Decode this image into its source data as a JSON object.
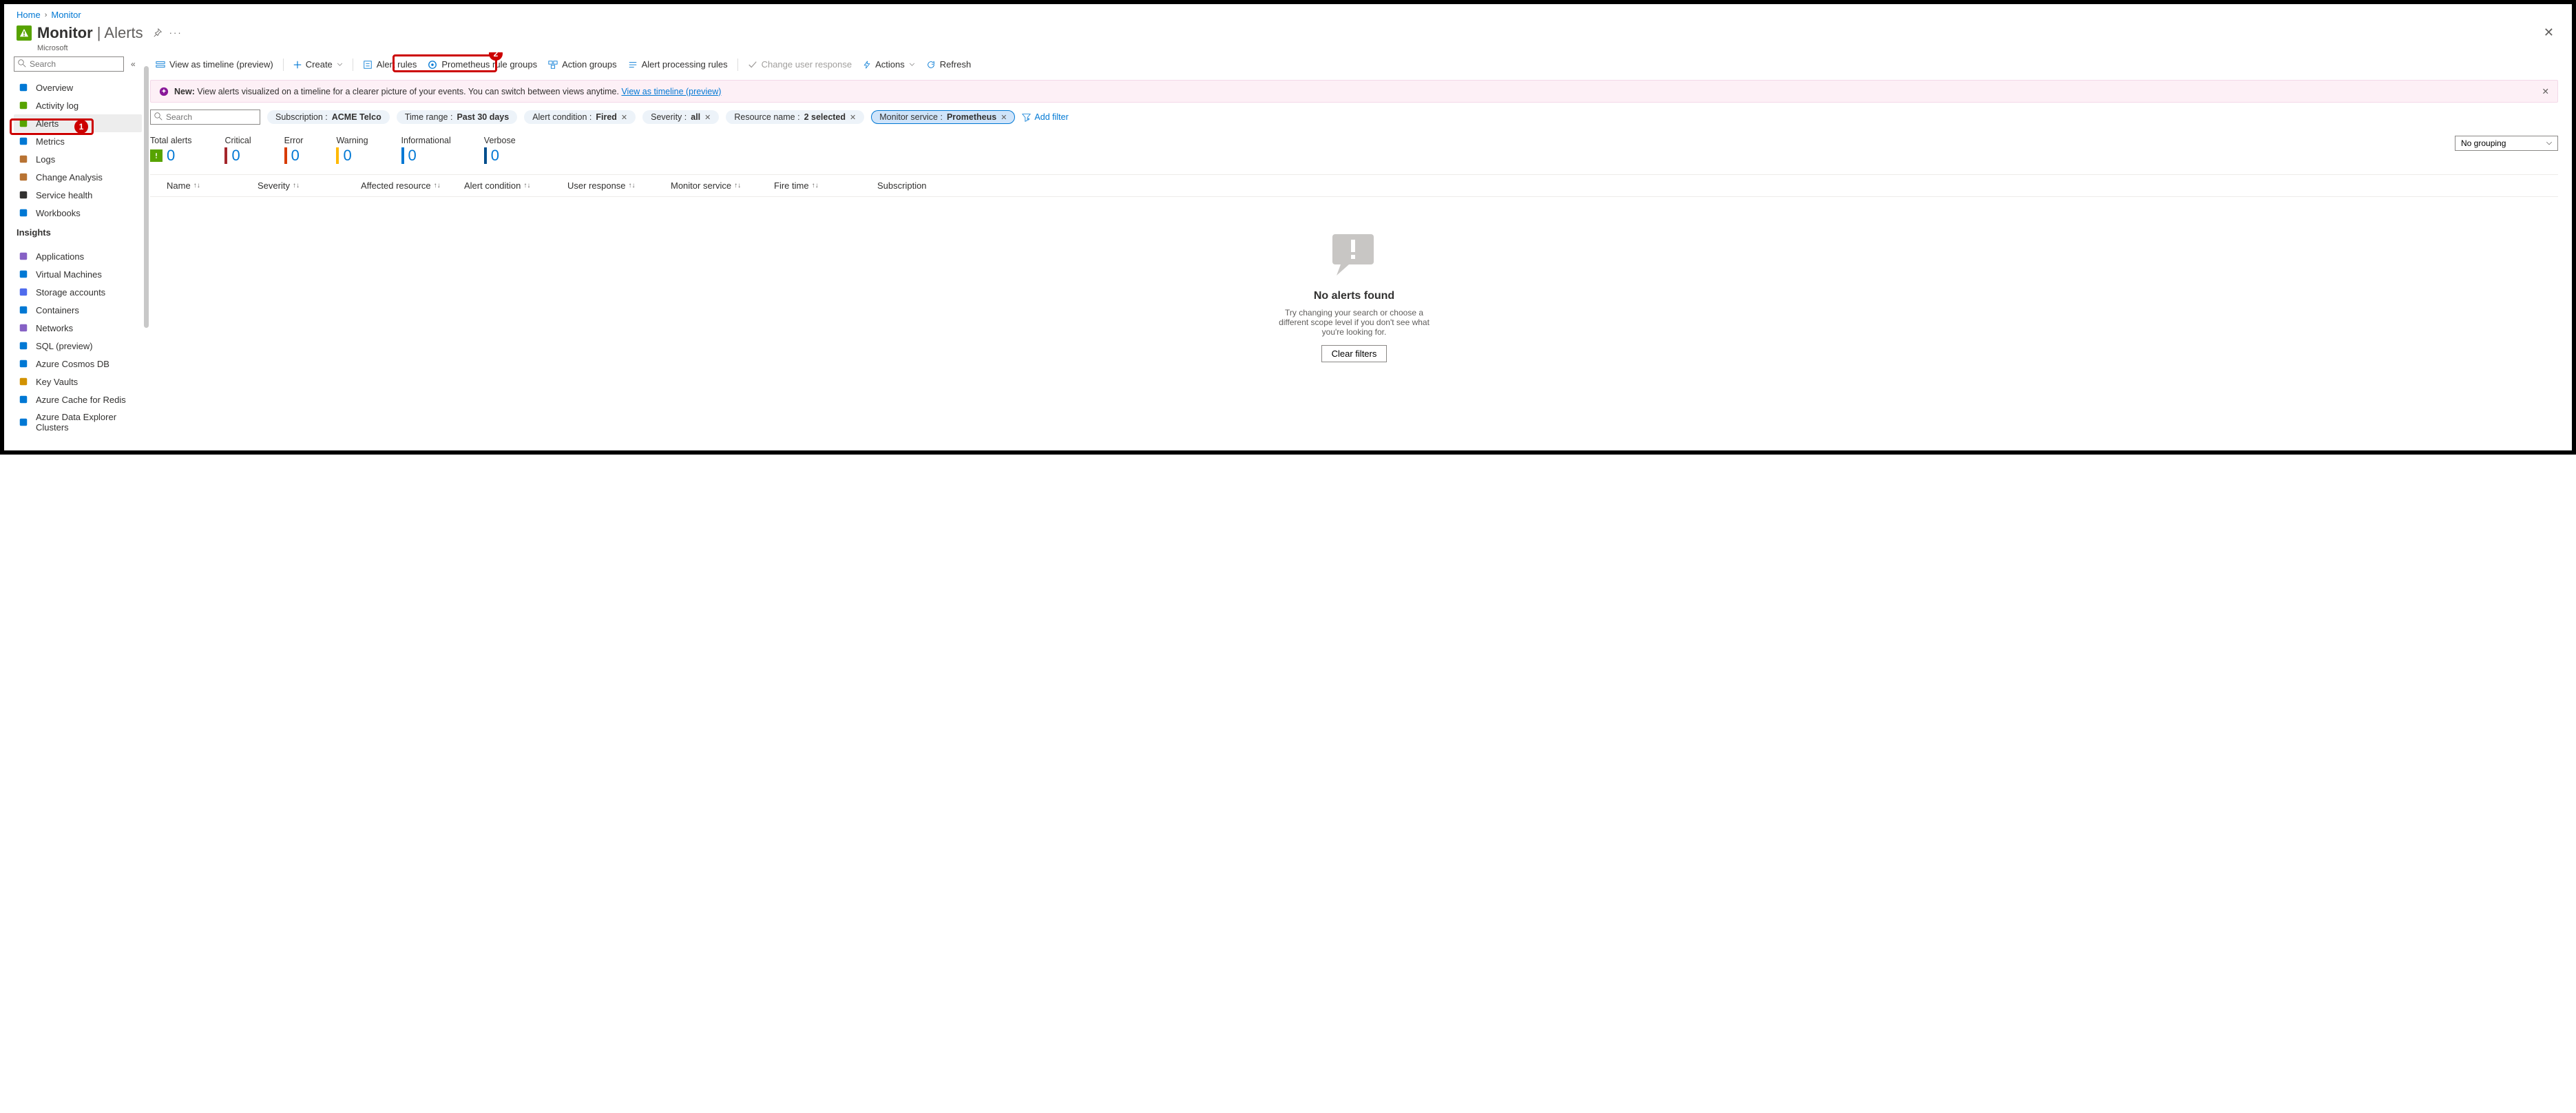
{
  "breadcrumb": {
    "home": "Home",
    "monitor": "Monitor"
  },
  "header": {
    "title": "Monitor",
    "section": "Alerts",
    "provider": "Microsoft"
  },
  "search": {
    "placeholder": "Search"
  },
  "sidebar": {
    "items": [
      {
        "label": "Overview",
        "icon": "gauge",
        "color": "#0078d4"
      },
      {
        "label": "Activity log",
        "icon": "log",
        "color": "#57a300"
      },
      {
        "label": "Alerts",
        "icon": "alert",
        "color": "#57a300",
        "active": true
      },
      {
        "label": "Metrics",
        "icon": "metrics",
        "color": "#0078d4"
      },
      {
        "label": "Logs",
        "icon": "logs",
        "color": "#b87333"
      },
      {
        "label": "Change Analysis",
        "icon": "change",
        "color": "#b87333"
      },
      {
        "label": "Service health",
        "icon": "heart",
        "color": "#323130"
      },
      {
        "label": "Workbooks",
        "icon": "workbook",
        "color": "#0078d4"
      }
    ],
    "insights_label": "Insights",
    "insights": [
      {
        "label": "Applications",
        "color": "#8661c5"
      },
      {
        "label": "Virtual Machines",
        "color": "#0078d4"
      },
      {
        "label": "Storage accounts",
        "color": "#4f6bed"
      },
      {
        "label": "Containers",
        "color": "#0078d4"
      },
      {
        "label": "Networks",
        "color": "#8661c5"
      },
      {
        "label": "SQL (preview)",
        "color": "#0078d4"
      },
      {
        "label": "Azure Cosmos DB",
        "color": "#0078d4"
      },
      {
        "label": "Key Vaults",
        "color": "#d29200"
      },
      {
        "label": "Azure Cache for Redis",
        "color": "#0078d4"
      },
      {
        "label": "Azure Data Explorer Clusters",
        "color": "#0078d4"
      }
    ]
  },
  "toolbar": {
    "timeline": "View as timeline (preview)",
    "create": "Create",
    "alert_rules": "Alert rules",
    "prom_groups": "Prometheus rule groups",
    "action_groups": "Action groups",
    "processing": "Alert processing rules",
    "change_resp": "Change user response",
    "actions": "Actions",
    "refresh": "Refresh"
  },
  "banner": {
    "label": "New:",
    "text": "View alerts visualized on a timeline for a clearer picture of your events. You can switch between views anytime.",
    "link": "View as timeline (preview)"
  },
  "filters": {
    "search_placeholder": "Search",
    "subscription": {
      "label": "Subscription : ",
      "value": "ACME Telco"
    },
    "time": {
      "label": "Time range : ",
      "value": "Past 30 days"
    },
    "condition": {
      "label": "Alert condition : ",
      "value": "Fired"
    },
    "severity": {
      "label": "Severity : ",
      "value": "all"
    },
    "resource": {
      "label": "Resource name : ",
      "value": "2 selected"
    },
    "monitor": {
      "label": "Monitor service : ",
      "value": "Prometheus"
    },
    "add": "Add filter"
  },
  "stats": {
    "total": {
      "label": "Total alerts",
      "value": "0"
    },
    "critical": {
      "label": "Critical",
      "value": "0",
      "color": "#a4262c"
    },
    "error": {
      "label": "Error",
      "value": "0",
      "color": "#d83b01"
    },
    "warning": {
      "label": "Warning",
      "value": "0",
      "color": "#ffb900"
    },
    "info": {
      "label": "Informational",
      "value": "0",
      "color": "#0078d4"
    },
    "verbose": {
      "label": "Verbose",
      "value": "0",
      "color": "#004e8c"
    }
  },
  "grouping": {
    "value": "No grouping"
  },
  "columns": {
    "name": "Name",
    "severity": "Severity",
    "affected": "Affected resource",
    "condition": "Alert condition",
    "response": "User response",
    "monitor": "Monitor service",
    "fire": "Fire time",
    "sub": "Subscription"
  },
  "empty": {
    "title": "No alerts found",
    "text": "Try changing your search or choose a different scope level if you don't see what you're looking for.",
    "button": "Clear filters"
  },
  "callouts": {
    "one": "1",
    "two": "2"
  }
}
